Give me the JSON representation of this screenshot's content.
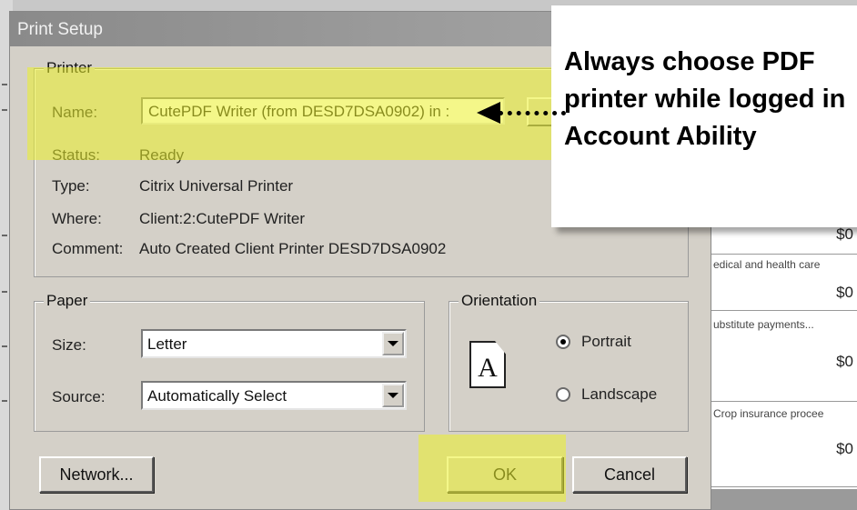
{
  "dialog": {
    "title": "Print Setup"
  },
  "printer": {
    "group_label": "Printer",
    "name_label": "Name:",
    "name_value": "CutePDF Writer (from DESD7DSA0902) in :",
    "status_label": "Status:",
    "status_value": "Ready",
    "type_label": "Type:",
    "type_value": "Citrix Universal Printer",
    "where_label": "Where:",
    "where_value": "Client:2:CutePDF Writer",
    "comment_label": "Comment:",
    "comment_value": "Auto Created Client Printer DESD7DSA0902"
  },
  "paper": {
    "group_label": "Paper",
    "size_label": "Size:",
    "size_value": "Letter",
    "source_label": "Source:",
    "source_value": "Automatically Select"
  },
  "orientation": {
    "group_label": "Orientation",
    "portrait_label": "Portrait",
    "landscape_label": "Landscape",
    "selected": "Portrait",
    "page_icon_letter": "A"
  },
  "buttons": {
    "network": "Network...",
    "ok": "OK",
    "cancel": "Cancel"
  },
  "callout": {
    "text": "Always choose PDF printer while logged in Account Ability"
  },
  "background_panel": {
    "rows": [
      {
        "label": "",
        "amount": "$0"
      },
      {
        "label": "edical and health care",
        "amount": "$0"
      },
      {
        "label": "ubstitute payments...",
        "amount": "$0"
      },
      {
        "label": "Crop insurance procee",
        "amount": "$0"
      }
    ]
  },
  "colors": {
    "highlight": "#ebf028",
    "dialog_bg": "#d4d0c8"
  }
}
